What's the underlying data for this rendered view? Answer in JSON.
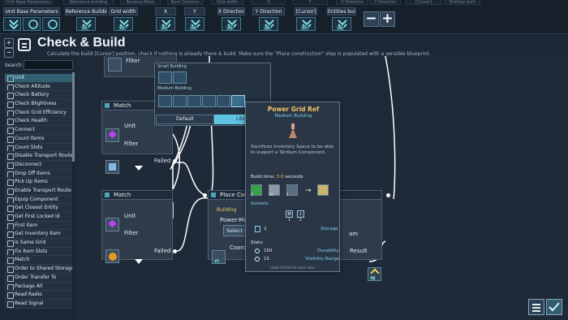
{
  "ghost_tabs": [
    "Unit Base Parameters",
    "Reference building",
    "Reverse Move",
    "Num Columns",
    "Grid width",
    "X",
    "Y",
    "X Direction",
    "Y Direction",
    "[Cursor]",
    "Entities built"
  ],
  "params": [
    {
      "label": "Unit Base Parameters",
      "icons": 3,
      "tag": ""
    },
    {
      "label": "Reference Building",
      "icons": 1,
      "tag": "P1"
    },
    {
      "label": "Grid width",
      "icons": 1,
      "tag": "P2"
    },
    {
      "label": "X",
      "icons": 1,
      "tag": "P3"
    },
    {
      "label": "Y",
      "icons": 1,
      "tag": "P4"
    },
    {
      "label": "X Direction",
      "icons": 1,
      "tag": "P5"
    },
    {
      "label": "Y Direction",
      "icons": 1,
      "tag": "P6"
    },
    {
      "label": "[Cursor]",
      "icons": 1,
      "tag": "P7"
    },
    {
      "label": "Entities built",
      "icons": 1,
      "tag": "P8"
    }
  ],
  "toolbar": {
    "minus": "−",
    "plus": "+"
  },
  "title": "Check & Build",
  "subtitle": "Calculate the build [Cursor] position, check if nothing is already there & build. Make sure the \"Place construction\" step is populated with a sensible blueprint.",
  "zoom": {
    "in": "+",
    "out": "−"
  },
  "search": {
    "label": "Search:",
    "placeholder": ""
  },
  "sidebar_items": [
    "Unit",
    "Check Altitude",
    "Check Battery",
    "Check Blightness",
    "Check Grid Efficiency",
    "Check Health",
    "Connect",
    "Count Items",
    "Count Slots",
    "Disable Transport Route",
    "Disconnect",
    "Drop Off Items",
    "Pick Up Items",
    "Enable Transport Route",
    "Equip Component",
    "Get Closest Entity",
    "Get First Locked Id",
    "First Item",
    "Get Inventory Item",
    "Is Same Grid",
    "Fix Item Slots",
    "Match",
    "Order to Shared Storage",
    "Order Transfer To",
    "Package All",
    "Read Radio",
    "Read Signal"
  ],
  "nodes": {
    "top_filter": "Filter",
    "match1": {
      "title": "Match",
      "unit": "Unit",
      "filter": "Filter",
      "failed": "Failed"
    },
    "match2": {
      "title": "Match",
      "unit": "Unit",
      "filter": "Filter",
      "failed": "Failed"
    },
    "place": {
      "title": "Place Cons",
      "building_label": "Building",
      "power": "Power-Ma",
      "select": "Select B",
      "coord": "Coordi",
      "tail": "am",
      "result": "Result",
      "p7": "P7",
      "p8": "P8"
    }
  },
  "picker": {
    "small": "Small Building",
    "medium": "Medium Building",
    "tab_default": "Default",
    "tab_library": "Library"
  },
  "tooltip": {
    "title": "Power Grid Ref",
    "subtitle": "Medium Building",
    "description": "Sacrifices Inventory Space to be able to support a Terdium Component.",
    "build_time_label": "Build time:",
    "build_time_value": "3.0",
    "build_time_unit": "seconds",
    "costs": [
      "2",
      "10",
      "1"
    ],
    "sockets_label": "Sockets:",
    "sockets": [
      {
        "letter": "M",
        "count": "1"
      },
      {
        "letter": "I",
        "count": "2"
      }
    ],
    "storage_count": "2",
    "storage_label": "Storage",
    "stats_label": "Stats:",
    "durability_value": "150",
    "durability_label": "Durability",
    "visibility_value": "15",
    "visibility_label": "Visibility Range",
    "hint": "(Hold Ctrl/Alt for more info)"
  },
  "colors": {
    "accent": "#5fc3e0",
    "gold": "#f0c46a",
    "background": "#1c2836"
  }
}
